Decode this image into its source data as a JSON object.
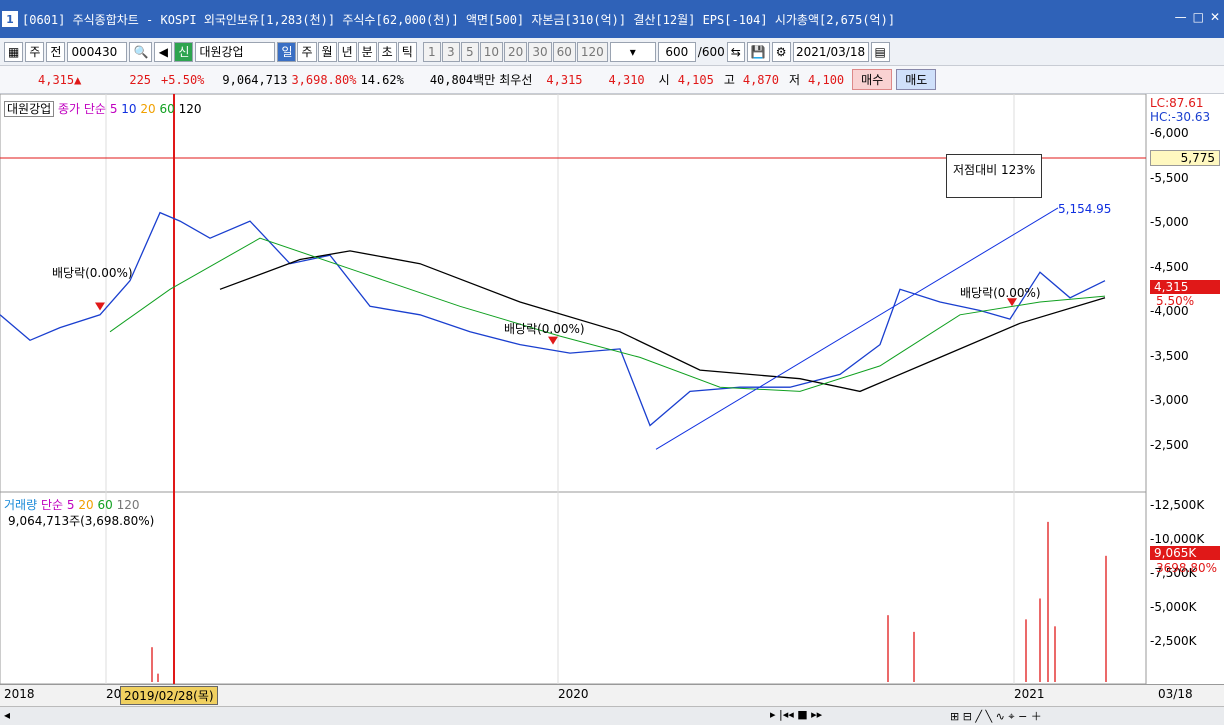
{
  "window": {
    "tab_number": "1",
    "title": "[0601] 주식종합차트 - KOSPI 외국인보유[1,283(천)] 주식수[62,000(천)] 액면[500] 자본금[310(억)] 결산[12월] EPS[-104] 시가총액[2,675(억)]"
  },
  "toolbar": {
    "period": "주",
    "jeon": "전",
    "code": "000430",
    "badge": "신",
    "name": "대원강업",
    "tabs": [
      "일",
      "주",
      "월",
      "년",
      "분",
      "초",
      "틱"
    ],
    "selected_tab": "일",
    "nums": [
      "1",
      "3",
      "5",
      "10",
      "20",
      "30",
      "60",
      "120"
    ],
    "count": "600",
    "count_total": "/600",
    "date": "2021/03/18"
  },
  "quote": {
    "price": "4,315",
    "arrow": "▲",
    "change": "225",
    "change_pct": "+5.50%",
    "volume": "9,064,713",
    "vol_pct": "3,698.80%",
    "turnover": "14.62%",
    "amount": "40,804백만",
    "best_label": "최우선",
    "ask": "4,315",
    "bid": "4,310",
    "open_label": "시",
    "open": "4,105",
    "high_label": "고",
    "high": "4,870",
    "low_label": "저",
    "low": "4,100",
    "buy": "매수",
    "sell": "매도"
  },
  "price_legend": {
    "name": "대원강업",
    "ma_label": "종가 단순",
    "ma": [
      "5",
      "10",
      "20",
      "60",
      "120"
    ]
  },
  "vol_legend": {
    "label": "거래량",
    "ma_label": "단순",
    "ma": [
      "5",
      "20",
      "60",
      "120"
    ],
    "value": "9,064,713주(3,698.80%)"
  },
  "annotations": {
    "box": "저점대비 123%",
    "peak": "5,154.95",
    "div1": "배당락(0.00%)",
    "div2": "배당락(0.00%)",
    "div3": "배당락(0.00%)"
  },
  "price_axis": {
    "lc": "LC:87.61",
    "hc": "HC:-30.63",
    "ticks": [
      "6,000",
      "5,500",
      "5,000",
      "4,500",
      "4,000",
      "3,500",
      "3,000",
      "2,500"
    ],
    "hline_label": "5,775",
    "cur_price": "4,315",
    "cur_pct": "5.50%"
  },
  "vol_axis": {
    "ticks": [
      "12,500K",
      "10,000K",
      "7,500K",
      "5,000K",
      "2,500K"
    ],
    "cur_vol": "9,065K",
    "cur_pct": "3698.80%"
  },
  "x_axis": {
    "labels": [
      "2018",
      "20",
      "2020",
      "2021"
    ],
    "cursor": "2019/02/28(목)",
    "end": "03/18"
  },
  "colors": {
    "ma5": "#c000c0",
    "ma10": "#1030e0",
    "ma20": "#f0a000",
    "ma60": "#10a020",
    "ma120": "#000000",
    "up": "#e01818",
    "down": "#1a3fcf"
  }
}
